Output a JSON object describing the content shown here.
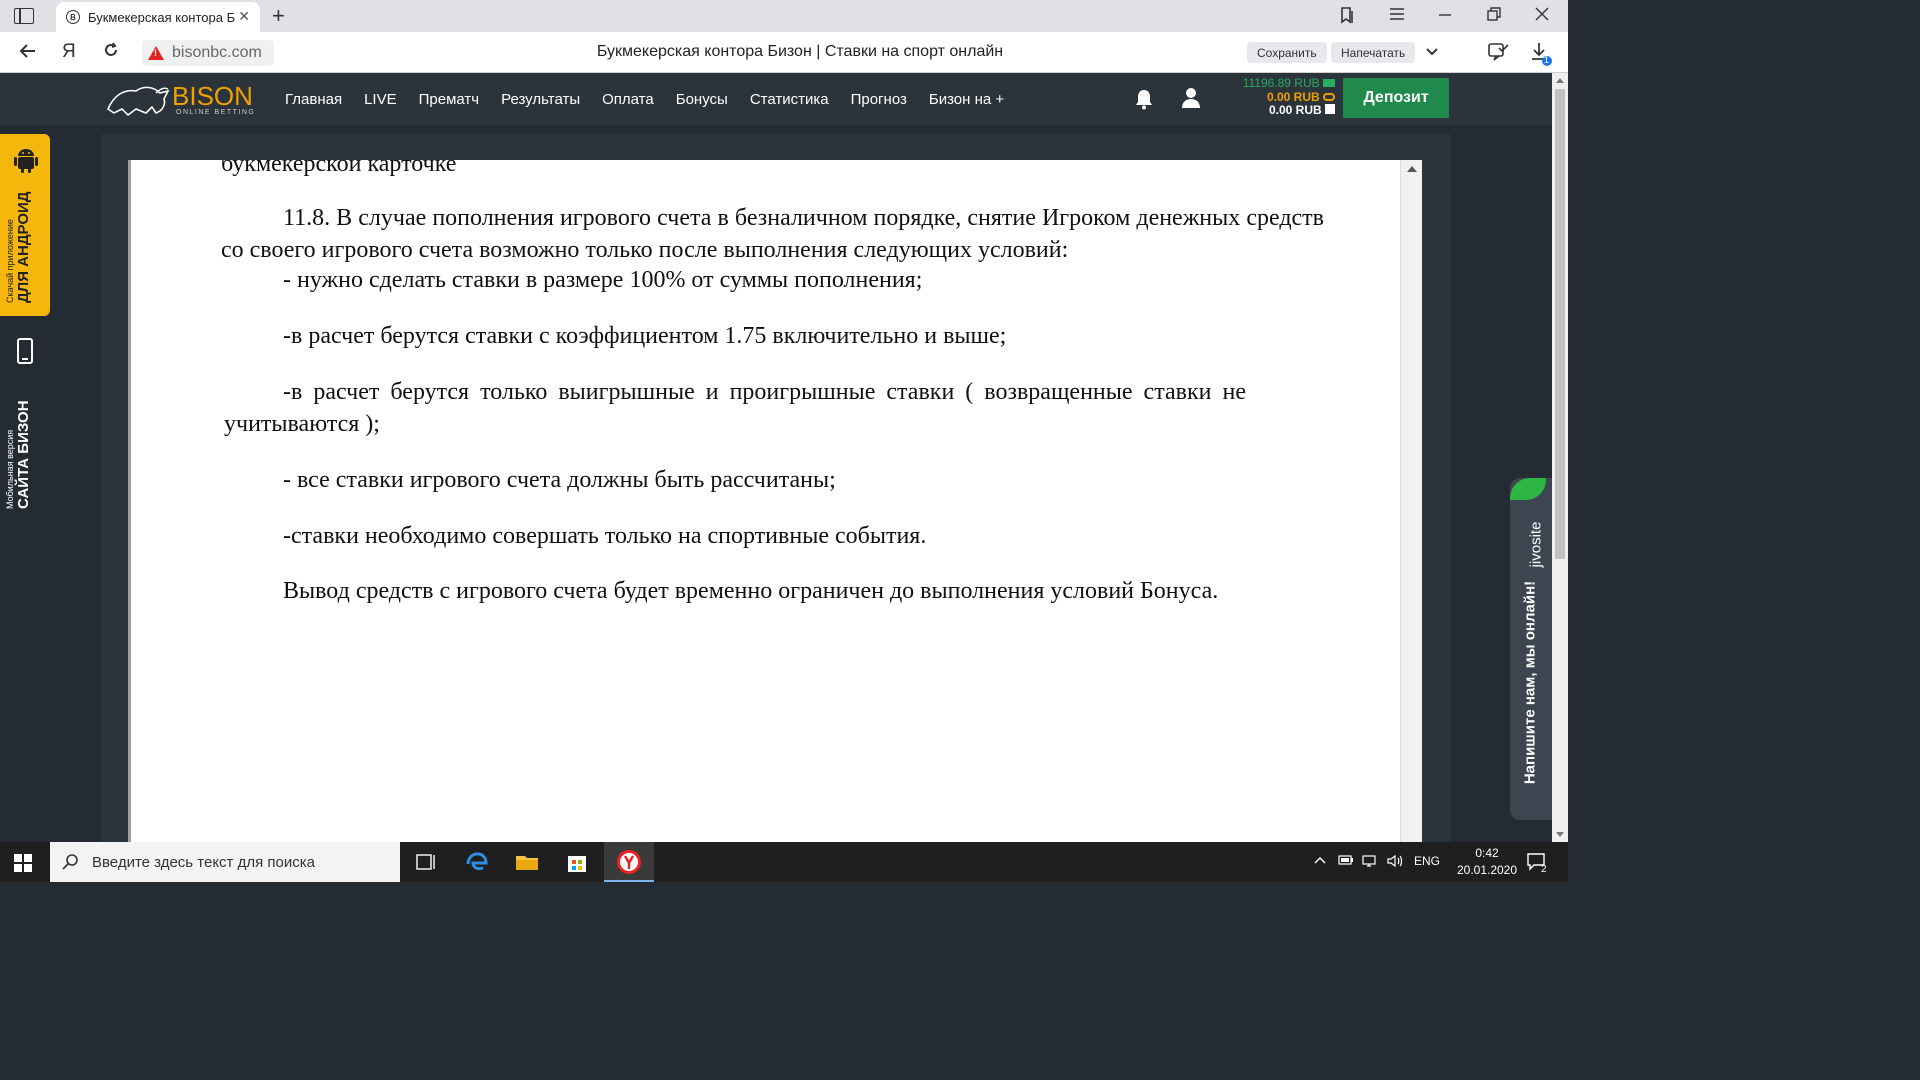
{
  "browser": {
    "tab_title": "Букмекерская контора Б",
    "url": "bisonbc.com",
    "page_title": "Букмекерская контора Бизон | Ставки на спорт онлайн",
    "save_label": "Сохранить",
    "print_label": "Напечатать",
    "download_badge": "1"
  },
  "site": {
    "logo_text": "BISON",
    "logo_sub": "ONLINE BETTING",
    "menu": [
      "Главная",
      "LIVE",
      "Прематч",
      "Результаты",
      "Оплата",
      "Бонусы",
      "Статистика",
      "Прогноз",
      "Бизон на +"
    ],
    "balance_main": "11196.89 RUB",
    "balance_bonus": "0.00 RUB",
    "balance_gift": "0.00 RUB",
    "deposit_label": "Депозит"
  },
  "promo": {
    "android_small": "Скачай приложение",
    "android_big": "ДЛЯ АНДРОИД",
    "mobile_small": "Мобильная версия",
    "mobile_big": "САЙТА БИЗОН"
  },
  "document": {
    "clipped_line": "букмекерской карточке",
    "para_11_8": "11.8. В случае пополнения игрового счета в безналичном порядке, снятие Игроком денежных средств со своего игрового счета возможно только после выполнения следующих условий:",
    "cond_1": "- нужно сделать ставки в размере 100% от суммы пополнения;",
    "cond_2": "-в расчет берутся ставки с коэффициентом 1.75 включительно и выше;",
    "cond_3": "-в расчет берутся только выигрышные и проигрышные ставки ( возвращенные ставки не учитываются );",
    "cond_4": "- все ставки игрового счета должны быть рассчитаны;",
    "cond_5": "-ставки необходимо совершать только на спортивные события.",
    "final": "Вывод средств с игрового счета будет временно ограничен до выполнения условий Бонуса."
  },
  "chat": {
    "brand": "jivosite",
    "cta": "Напишите нам, мы онлайн!"
  },
  "taskbar": {
    "search_placeholder": "Введите здесь текст для поиска",
    "lang": "ENG",
    "time": "0:42",
    "date": "20.01.2020",
    "notif_count": "2"
  },
  "colors": {
    "accent_orange": "#f0a000",
    "deposit_green": "#1f8a4c",
    "balance_green": "#27ae60",
    "header_bg": "#2b333b"
  }
}
